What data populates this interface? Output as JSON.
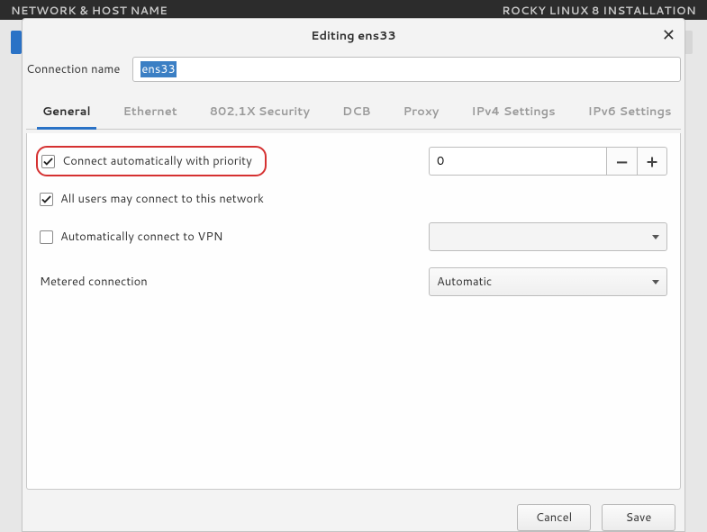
{
  "bg": {
    "left_text": "NETWORK & HOST NAME",
    "right_text": "ROCKY LINUX 8 INSTALLATION"
  },
  "dialog": {
    "title": "Editing ens33",
    "close_glyph": "✕"
  },
  "conn": {
    "label": "Connection name",
    "value": "ens33"
  },
  "tabs": [
    {
      "label": "General"
    },
    {
      "label": "Ethernet"
    },
    {
      "label": "802.1X Security"
    },
    {
      "label": "DCB"
    },
    {
      "label": "Proxy"
    },
    {
      "label": "IPv4 Settings"
    },
    {
      "label": "IPv6 Settings"
    }
  ],
  "general": {
    "auto_priority_label": "Connect automatically with priority",
    "priority_value": "0",
    "minus_glyph": "−",
    "plus_glyph": "+",
    "all_users_label": "All users may connect to this network",
    "auto_vpn_label": "Automatically connect to VPN",
    "metered_label": "Metered connection",
    "metered_value": "Automatic"
  },
  "footer": {
    "cancel": "Cancel",
    "save": "Save"
  }
}
